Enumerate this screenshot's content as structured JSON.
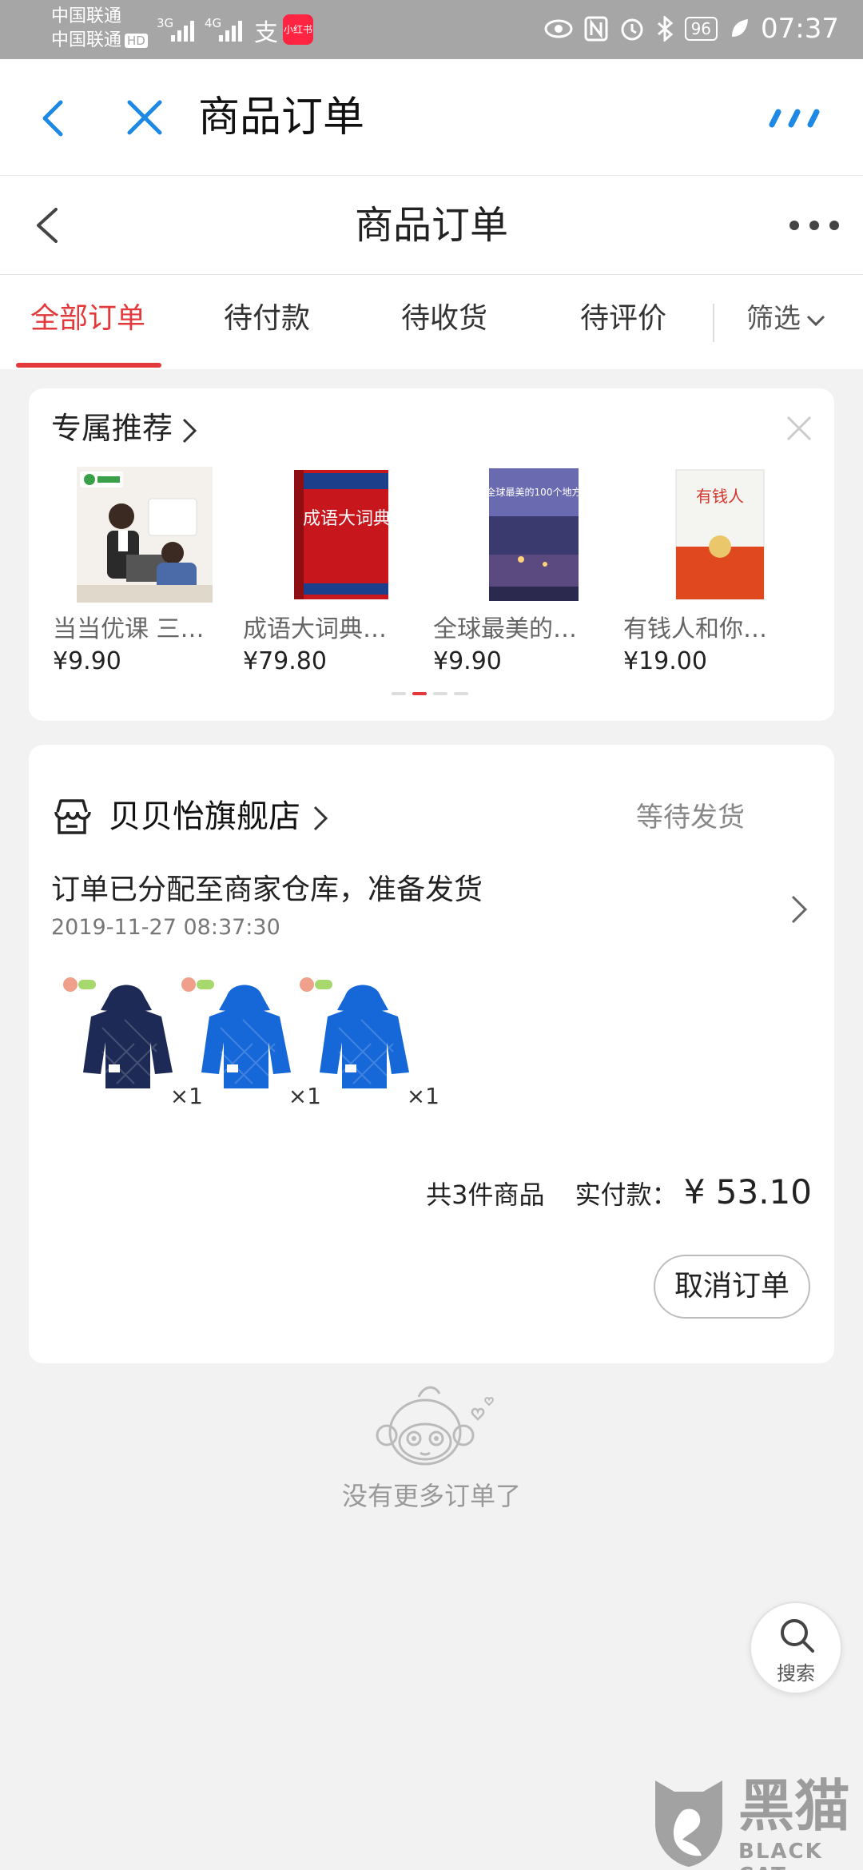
{
  "status_bar": {
    "carrier_1": "中国联通",
    "carrier_2": "中国联通",
    "hd": "HD",
    "sig1": "3G",
    "sig2": "4G",
    "app_badge": "小红书",
    "battery": "96",
    "time": "07:37"
  },
  "browser_bar": {
    "title": "商品订单"
  },
  "page_header": {
    "title": "商品订单"
  },
  "tabs": [
    {
      "label": "全部订单",
      "active": true
    },
    {
      "label": "待付款"
    },
    {
      "label": "待收货"
    },
    {
      "label": "待评价"
    }
  ],
  "filter_label": "筛选",
  "recommend": {
    "title": "专属推荐",
    "items": [
      {
        "name": "当当优课 三…",
        "price": "¥9.90"
      },
      {
        "name": "成语大词典…",
        "price": "¥79.80",
        "cover_text": "成语大词典"
      },
      {
        "name": "全球最美的…",
        "price": "¥9.90",
        "cover_text": "全球最美的100个地方"
      },
      {
        "name": "有钱人和你…",
        "price": "¥19.00",
        "cover_text": "有钱人"
      }
    ],
    "page_index": 1,
    "page_count": 4
  },
  "order": {
    "shop_name": "贝贝怡旗舰店",
    "status": "等待发货",
    "message": "订单已分配至商家仓库，准备发货",
    "time": "2019-11-27 08:37:30",
    "products": [
      {
        "qty": "×1",
        "color": "#1d2a55"
      },
      {
        "qty": "×1",
        "color": "#1668d8"
      },
      {
        "qty": "×1",
        "color": "#1668d8"
      }
    ],
    "count_text": "共3件商品",
    "paid_label": "实付款：",
    "amount": "¥ 53.10",
    "cancel_label": "取消订单"
  },
  "empty_text": "没有更多订单了",
  "search_fab_label": "搜索",
  "watermark": {
    "cn": "黑猫",
    "en": "BLACK CAT"
  },
  "colors": {
    "accent": "#e4393c",
    "browser_blue": "#1e88e5"
  }
}
